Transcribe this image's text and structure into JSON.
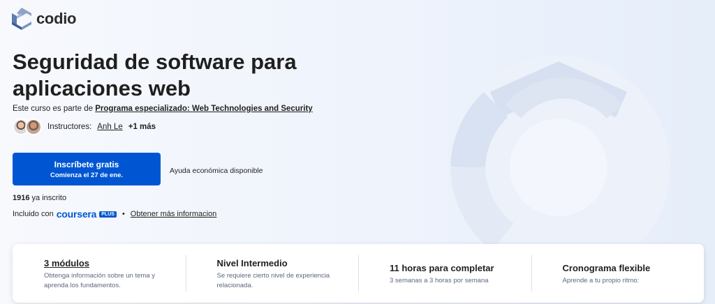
{
  "brand": {
    "name": "codio"
  },
  "course": {
    "title": "Seguridad de software para aplicaciones web",
    "program_prefix": "Este curso es parte de ",
    "program_link": "Programa especializado: Web Technologies and Security"
  },
  "instructors": {
    "label": "Instructores:",
    "name": "Anh Le",
    "more": "+1 más"
  },
  "enroll": {
    "label": "Inscríbete gratis",
    "sublabel": "Comienza el 27 de ene."
  },
  "financial_aid": "Ayuda económica disponible",
  "enrolled": {
    "count": "1916",
    "suffix": " ya inscrito"
  },
  "included": {
    "prefix": "Incluido con",
    "brand": "coursera",
    "badge": "PLUS",
    "separator": "•",
    "link": "Obtener más informacion"
  },
  "info": [
    {
      "title": "3 módulos",
      "desc": "Obtenga información sobre un tema y aprenda los fundamentos."
    },
    {
      "title": "Nivel Intermedio",
      "desc": "Se requiere cierto nivel de experiencia relacionada."
    },
    {
      "title": "11 horas para completar",
      "desc": "3 semanas a 3 horas por semana"
    },
    {
      "title": "Cronograma flexible",
      "desc": "Aprende a tu propio ritmo:"
    }
  ],
  "colors": {
    "primary": "#0056d2",
    "text": "#1f1f1f"
  }
}
